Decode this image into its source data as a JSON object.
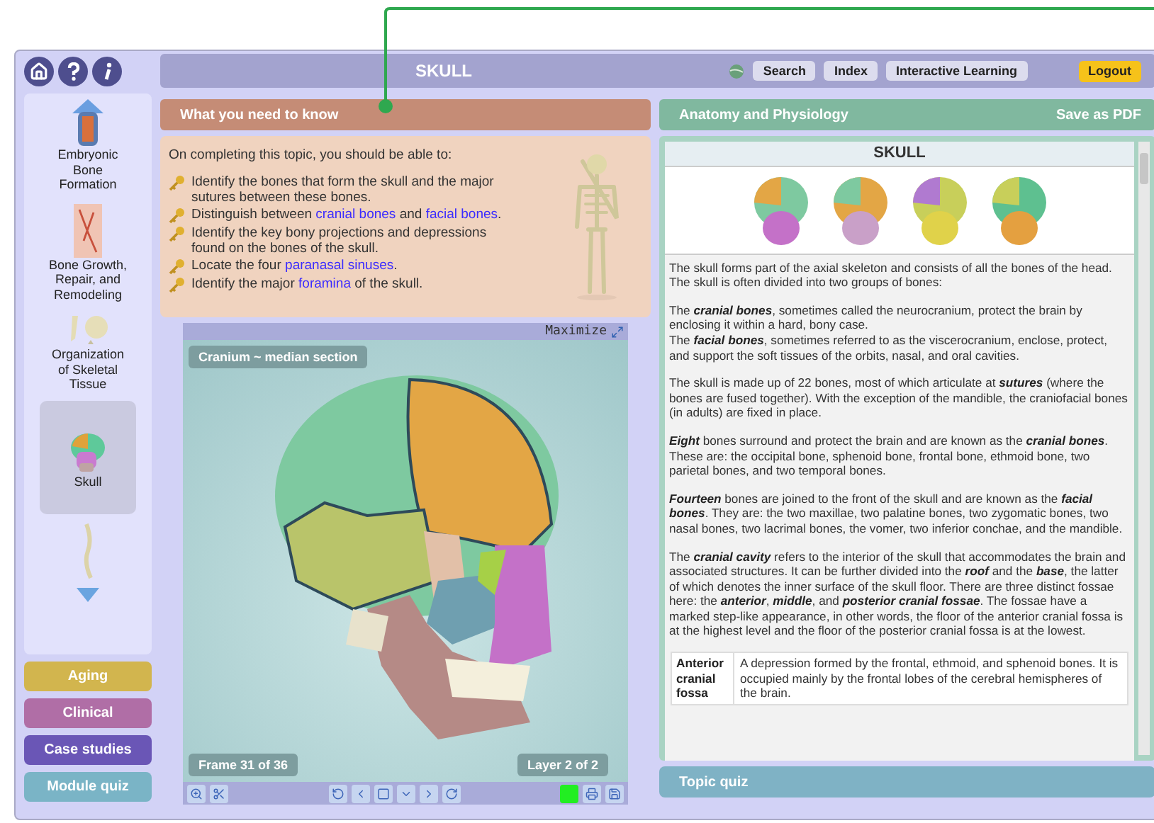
{
  "header": {
    "title": "SKULL",
    "buttons": [
      {
        "label": "Search"
      },
      {
        "label": "Index"
      },
      {
        "label": "Interactive Learning"
      }
    ],
    "logout": "Logout"
  },
  "sidebar": {
    "topics": [
      {
        "kind": "cartilage",
        "label": "Embryonic Bone Formation",
        "selected": false
      },
      {
        "kind": "bone",
        "label": "Bone Growth, Repair, and Remodeling",
        "selected": false
      },
      {
        "kind": "tissue",
        "label": "Organization of Skeletal Tissue",
        "selected": false
      },
      {
        "kind": "skull",
        "label": "Skull",
        "selected": true
      },
      {
        "kind": "spine",
        "selected": false
      }
    ],
    "categories": [
      {
        "label": "Aging",
        "color": "#d2b54e"
      },
      {
        "label": "Clinical",
        "color": "#b06ea6"
      },
      {
        "label": "Case studies",
        "color": "#6a56b6"
      },
      {
        "label": "Module quiz",
        "color": "#7ab4c6"
      }
    ]
  },
  "objectives": {
    "header": "What you need to know",
    "intro": "On completing this topic, you should be able to:",
    "items": [
      [
        {
          "kind": "plain",
          "text": "Identify the bones that form the skull and the major sutures between these bones."
        }
      ],
      [
        {
          "kind": "plain",
          "text": "Distinguish between "
        },
        {
          "kind": "link",
          "text": "cranial bones"
        },
        {
          "kind": "plain",
          "text": " and "
        },
        {
          "kind": "link",
          "text": "facial bones"
        },
        {
          "kind": "plain",
          "text": "."
        }
      ],
      [
        {
          "kind": "plain",
          "text": "Identify the key bony projections and depressions found on the bones of the skull."
        }
      ],
      [
        {
          "kind": "plain",
          "text": "Locate the four "
        },
        {
          "kind": "link",
          "text": "paranasal sinuses"
        },
        {
          "kind": "plain",
          "text": "."
        }
      ],
      [
        {
          "kind": "plain",
          "text": "Identify the major "
        },
        {
          "kind": "link",
          "text": "foramina"
        },
        {
          "kind": "plain",
          "text": " of the skull."
        }
      ]
    ]
  },
  "viewer": {
    "maximize": "Maximize",
    "caption": "Cranium ~ median section",
    "frame": "Frame 31 of 36",
    "layer": "Layer 2 of 2"
  },
  "article": {
    "header": "Anatomy and Physiology",
    "save": "Save as PDF",
    "title": "SKULL",
    "paragraphs": [
      [
        "The skull forms part of the axial skeleton and consists of all the bones of the head. The skull is often divided into two groups of bones:"
      ],
      [
        "The **cranial bones**, sometimes called the neurocranium, protect the brain by enclosing it within a hard, bony case.",
        "The **facial bones**, sometimes referred to as the viscerocranium, enclose, protect, and support the soft tissues of the orbits, nasal, and oral cavities."
      ],
      [
        "The skull is made up of 22 bones, most of which articulate at **sutures** (where the bones are fused together). With the exception of the mandible, the craniofacial bones (in adults) are fixed in place."
      ],
      [
        "**Eight** bones surround and protect the brain and are known as the **cranial bones**. These are: the occipital bone, sphenoid bone, frontal bone, ethmoid bone, two parietal bones, and two temporal bones."
      ],
      [
        "**Fourteen** bones are joined to the front of the skull and are known as the **facial bones**. They are: the two maxillae, two palatine bones, two zygomatic bones, two nasal bones, two lacrimal bones, the vomer, two inferior conchae, and the mandible."
      ],
      [
        "The **cranial cavity** refers to the interior of the skull that accommodates the brain and associated structures. It can be further divided into the **roof** and the **base**, the latter of which denotes the inner surface of the skull floor. There are three distinct fossae here: the **anterior**, **middle**, and **posterior cranial fossae**. The fossae have a marked step-like appearance, in other words, the floor of the anterior cranial fossa is at the highest level and the floor of the posterior cranial fossa is at the lowest."
      ]
    ],
    "table": [
      {
        "term": "Anterior cranial fossa",
        "definition": "A depression formed by the frontal, ethmoid, and sphenoid bones. It is occupied mainly by the frontal lobes of the cerebral hemispheres of the brain."
      }
    ]
  },
  "topic_quiz": "Topic quiz"
}
